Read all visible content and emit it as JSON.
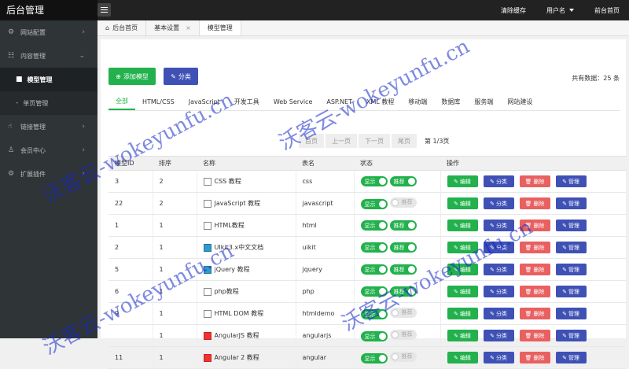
{
  "topbar": {
    "brand": "后台管理",
    "nav": [
      "清除缓存",
      "用户名",
      "前台首页"
    ]
  },
  "sidebar": {
    "items": [
      {
        "label": "网站配置",
        "icon": "gear-icon",
        "glyph": "⚙"
      },
      {
        "label": "内容管理",
        "icon": "sliders-icon",
        "glyph": "☷"
      },
      {
        "label": "链接管理",
        "icon": "thumbs-up-icon",
        "glyph": "👍"
      },
      {
        "label": "会员中心",
        "icon": "user-icon",
        "glyph": "👤"
      },
      {
        "label": "扩展插件",
        "icon": "plugin-icon",
        "glyph": "⚙"
      }
    ],
    "sub": [
      "模型管理",
      "单页管理"
    ]
  },
  "tabs": [
    "后台首页",
    "基本设置",
    "模型管理"
  ],
  "toolbar": {
    "add": "添加模型",
    "cat": "分类",
    "total": "共有数据：25 条"
  },
  "filters": [
    "全部",
    "HTML/CSS",
    "JavaScript",
    "开发工具",
    "Web Service",
    "ASP.NET",
    "XML 教程",
    "移动端",
    "数据库",
    "服务端",
    "网站建设"
  ],
  "pager": [
    "首页",
    "上一页",
    "下一页",
    "尾页",
    "第 1/3页"
  ],
  "table": {
    "headers": [
      "模型ID",
      "排序",
      "名称",
      "表名",
      "状态",
      "操作"
    ],
    "rows": [
      {
        "id": "3",
        "sort": "2",
        "name": "CSS 教程",
        "table": "css"
      },
      {
        "id": "22",
        "sort": "2",
        "name": "JavaScript 教程",
        "table": "javascript"
      },
      {
        "id": "1",
        "sort": "1",
        "name": "HTML教程",
        "table": "html"
      },
      {
        "id": "2",
        "sort": "1",
        "name": "UIkit3.x中文文档",
        "table": "uikit"
      },
      {
        "id": "5",
        "sort": "1",
        "name": "jQuery 教程",
        "table": "jquery"
      },
      {
        "id": "6",
        "sort": "1",
        "name": "php教程",
        "table": "php"
      },
      {
        "id": "9",
        "sort": "1",
        "name": "HTML DOM 教程",
        "table": "htmldemo"
      },
      {
        "id": "",
        "sort": "1",
        "name": "AngularJS 教程",
        "table": "angularjs"
      },
      {
        "id": "11",
        "sort": "1",
        "name": "Angular 2 教程",
        "table": "angular"
      }
    ],
    "status": {
      "show": "显示",
      "recommend": "推荐"
    },
    "ops": {
      "edit": "编辑",
      "cat": "分类",
      "del": "删除",
      "mgr": "管理"
    }
  },
  "watermark": "沃客云-wokeyunfu.cn"
}
